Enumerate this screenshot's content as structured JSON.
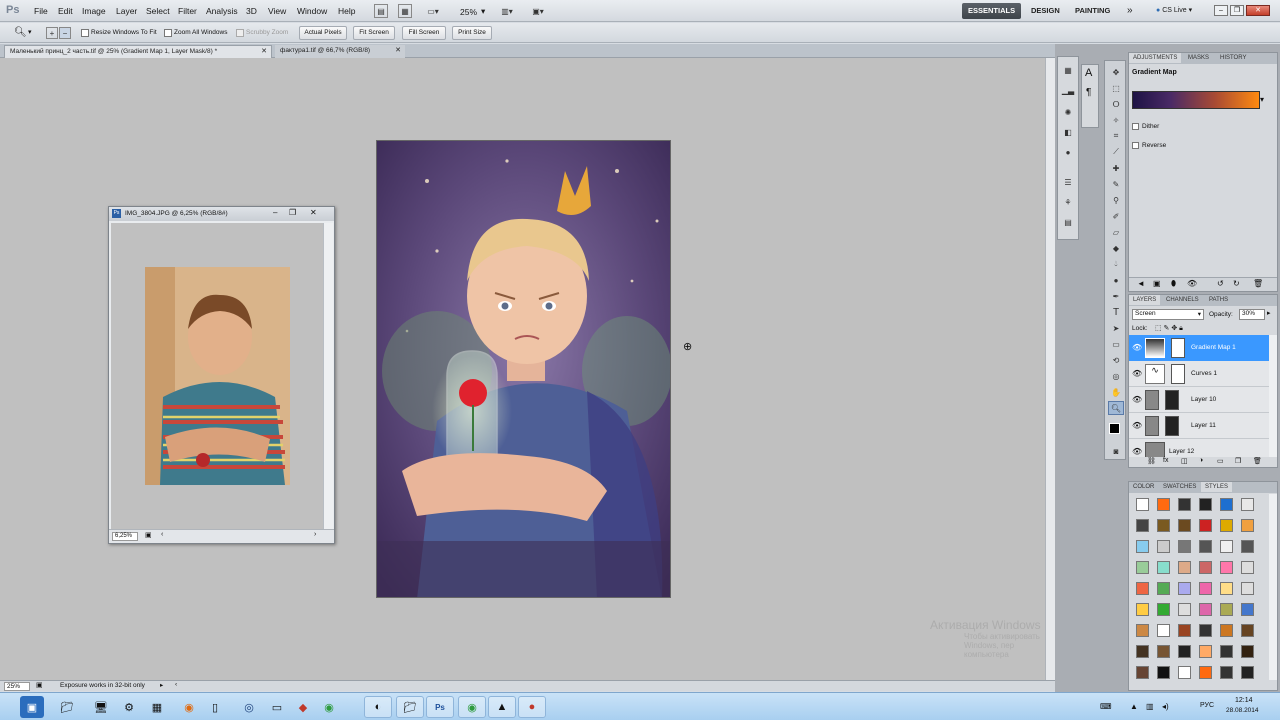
{
  "app": {
    "logo": "Ps"
  },
  "menu": [
    "File",
    "Edit",
    "Image",
    "Layer",
    "Select",
    "Filter",
    "Analysis",
    "3D",
    "View",
    "Window",
    "Help"
  ],
  "zoom_select": "25%",
  "workspaces": [
    "ESSENTIALS",
    "DESIGN",
    "PAINTING"
  ],
  "cs_live": "CS Live",
  "options": {
    "resize_windows": "Resize Windows To Fit",
    "zoom_all": "Zoom All Windows",
    "scrubby_zoom": "Scrubby Zoom",
    "actual_pixels": "Actual Pixels",
    "fit_screen": "Fit Screen",
    "fill_screen": "Fill Screen",
    "print_size": "Print Size"
  },
  "tabs": [
    {
      "label": "Маленький принц_2 часть.tif @ 25% (Gradient Map 1, Layer Mask/8) *"
    },
    {
      "label": "фактура1.tif @ 66,7% (RGB/8)"
    }
  ],
  "float_window": {
    "title": "IMG_3804.JPG @ 6,25% (RGB/8#)",
    "zoom": "6,25%"
  },
  "status": {
    "zoom": "25%",
    "message": "Exposure works in 32-bit only"
  },
  "panels": {
    "adjustments": {
      "tabs": [
        "ADJUSTMENTS",
        "MASKS",
        "HISTORY"
      ],
      "title": "Gradient Map",
      "dither": "Dither",
      "reverse": "Reverse"
    },
    "layers": {
      "tabs": [
        "LAYERS",
        "CHANNELS",
        "PATHS"
      ],
      "blend": "Screen",
      "opacity_label": "Opacity:",
      "opacity": "30%",
      "lock_label": "Lock:",
      "items": [
        {
          "name": "Gradient Map 1",
          "selected": true
        },
        {
          "name": "Curves 1"
        },
        {
          "name": "Layer 10"
        },
        {
          "name": "Layer 11"
        },
        {
          "name": "Layer 12"
        }
      ]
    },
    "color": {
      "tabs": [
        "COLOR",
        "SWATCHES",
        "STYLES"
      ]
    }
  },
  "watermark": {
    "title": "Активация Windows",
    "line1": "Чтобы активировать Windows, пер",
    "line2": "компьютера"
  },
  "taskbar": {
    "lang": "РУС",
    "time": "12:14",
    "date": "28.08.2014"
  },
  "colors": {
    "accent": "#3a98ff",
    "gradient_start": "#2a1655",
    "gradient_end": "#ff8a10"
  }
}
